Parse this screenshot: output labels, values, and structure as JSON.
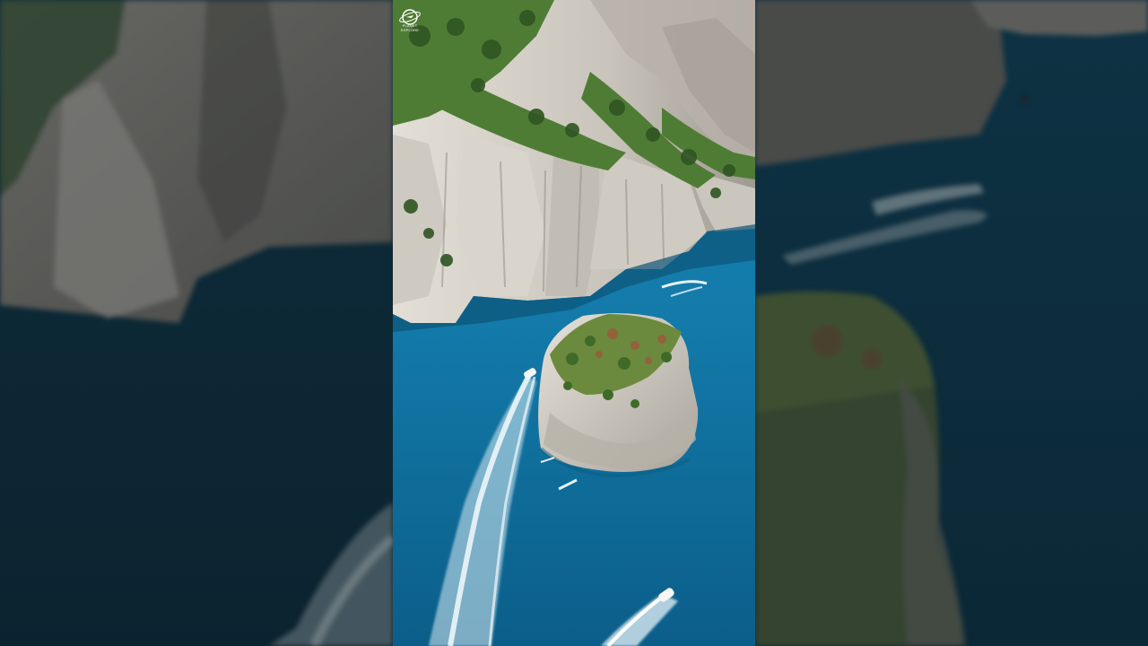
{
  "scene": {
    "description_free": true,
    "colors": {
      "sea_deep": "#0e5e86",
      "sea_mid": "#1379a8",
      "sea_dark_side": "#123444",
      "cliff_light": "#d8d4cc",
      "cliff_shadow": "#8e8a82",
      "vegetation": "#4e7a34",
      "vegetation_dark": "#2f5522",
      "wake": "#e8f4fa",
      "sky": "#cfe6f2"
    }
  },
  "watermark": {
    "icon": "globe-plane-logo-icon",
    "text": "PLANET EXPLORE"
  }
}
